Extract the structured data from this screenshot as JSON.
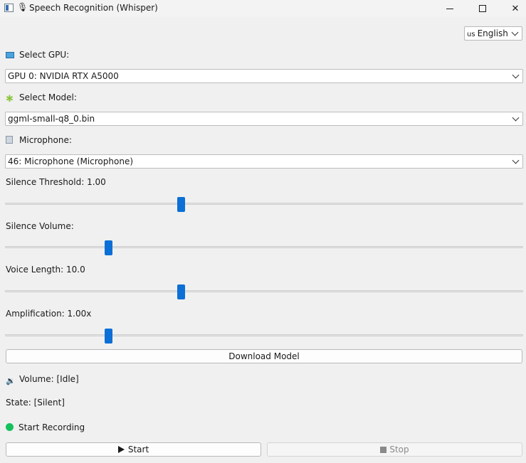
{
  "window": {
    "title": "Speech Recognition (Whisper)",
    "minimize_glyph": "",
    "close_glyph": "✕"
  },
  "language": {
    "flag": "us",
    "value": "English"
  },
  "gpu": {
    "label": "Select GPU:",
    "value": "GPU 0: NVIDIA RTX A5000"
  },
  "model": {
    "label": "Select Model:",
    "value": "ggml-small-q8_0.bin"
  },
  "microphone": {
    "label": "Microphone:",
    "value": "46: Microphone (Microphone)"
  },
  "sliders": {
    "silence_threshold": {
      "label": "Silence Threshold: 1.00",
      "level": 0.34
    },
    "silence_volume": {
      "label": "Silence Volume:",
      "level": 0.2
    },
    "voice_length": {
      "label": "Voice Length: 10.0",
      "level": 0.34
    },
    "amplification": {
      "label": "Amplification: 1.00x",
      "level": 0.2
    }
  },
  "download_button": "Download Model",
  "status": {
    "volume": "Volume: [Idle]",
    "state": "State: [Silent]",
    "recording": "Start Recording",
    "recording_color": "#15c15d"
  },
  "controls": {
    "start": "Start",
    "stop": "Stop"
  },
  "colors": {
    "accent": "#0b6fd6"
  }
}
